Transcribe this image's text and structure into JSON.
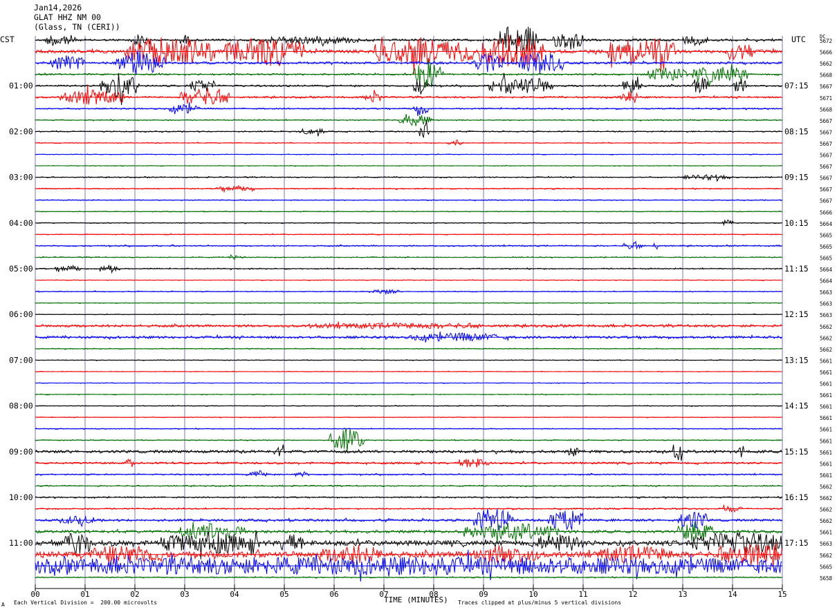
{
  "header": {
    "date": "Jan14,2026",
    "station": "GLAT HHZ NM 00",
    "location": "(Glass, TN (CERI))"
  },
  "left_timezone": "CST",
  "right_timezone": "UTC",
  "dc_label": "DC",
  "footer": {
    "scale_note": "Each Vertical Division =  200.00 microvolts",
    "clip_note": "Traces clipped at plus/minus 5 vertical divisions",
    "corner_mark": "A"
  },
  "colors": [
    "#000000",
    "#ff0000",
    "#0000ff",
    "#007000"
  ],
  "chart_data": {
    "type": "line",
    "title": "GLAT HHZ NM 00",
    "xlabel": "TIME (MINUTES)",
    "x_ticks": [
      "00",
      "01",
      "02",
      "03",
      "04",
      "05",
      "06",
      "07",
      "08",
      "09",
      "10",
      "11",
      "12",
      "13",
      "14",
      "15"
    ],
    "xlim": [
      0,
      15
    ],
    "grid": true,
    "rows": 48,
    "left_hour_labels": [
      "01:00",
      "02:00",
      "03:00",
      "04:00",
      "05:00",
      "06:00",
      "07:00",
      "08:00",
      "09:00",
      "10:00",
      "11:00"
    ],
    "right_hour_labels": [
      "07:15",
      "08:15",
      "09:15",
      "10:15",
      "11:15",
      "12:15",
      "13:15",
      "14:15",
      "15:15",
      "16:15",
      "17:15"
    ],
    "dc_offsets": [
      "5672",
      "5666",
      "5662",
      "5668",
      "5667",
      "5671",
      "5668",
      "5667",
      "5667",
      "5667",
      "5667",
      "5667",
      "5667",
      "5667",
      "5667",
      "5666",
      "5664",
      "5665",
      "5665",
      "5665",
      "5664",
      "5664",
      "5663",
      "5663",
      "5663",
      "5662",
      "5662",
      "5662",
      "5661",
      "5661",
      "5661",
      "5661",
      "5661",
      "5661",
      "5661",
      "5661",
      "5661",
      "5661",
      "5661",
      "5662",
      "5662",
      "5662",
      "5662",
      "5661",
      "5663",
      "5662",
      "5665",
      "5658"
    ],
    "row_noise": [
      {
        "row": 0,
        "base": 0.18,
        "events": [
          [
            0.2,
            0.8,
            1.2
          ],
          [
            1.9,
            2.3,
            1.0
          ],
          [
            2.9,
            3.1,
            0.9
          ],
          [
            4.5,
            6.5,
            0.6
          ],
          [
            9.3,
            10.1,
            3.0
          ],
          [
            10.4,
            11.0,
            1.8
          ],
          [
            13.0,
            13.5,
            0.8
          ]
        ]
      },
      {
        "row": 1,
        "base": 0.3,
        "events": [
          [
            1.8,
            3.6,
            2.6
          ],
          [
            3.8,
            5.4,
            2.6
          ],
          [
            6.8,
            8.8,
            2.4
          ],
          [
            8.9,
            10.2,
            3.0
          ],
          [
            11.5,
            12.9,
            2.6
          ],
          [
            13.8,
            14.4,
            1.6
          ]
        ]
      },
      {
        "row": 2,
        "base": 0.2,
        "events": [
          [
            0.3,
            1.0,
            1.4
          ],
          [
            1.6,
            2.6,
            2.2
          ],
          [
            8.8,
            9.4,
            1.6
          ],
          [
            9.7,
            10.6,
            2.0
          ]
        ]
      },
      {
        "row": 3,
        "base": 0.14,
        "events": [
          [
            7.6,
            8.2,
            2.6
          ],
          [
            12.3,
            13.1,
            1.2
          ],
          [
            13.2,
            14.3,
            1.5
          ]
        ]
      },
      {
        "row": 4,
        "base": 0.15,
        "events": [
          [
            1.3,
            2.1,
            2.4
          ],
          [
            3.1,
            3.6,
            1.3
          ],
          [
            7.6,
            7.9,
            1.6
          ],
          [
            9.1,
            10.4,
            1.6
          ],
          [
            11.8,
            12.2,
            2.0
          ],
          [
            13.2,
            13.5,
            1.6
          ],
          [
            14.0,
            14.3,
            1.2
          ]
        ]
      },
      {
        "row": 5,
        "base": 0.15,
        "events": [
          [
            0.5,
            1.8,
            1.3
          ],
          [
            2.9,
            3.9,
            1.6
          ],
          [
            6.6,
            7.0,
            0.8
          ],
          [
            11.7,
            12.1,
            1.1
          ]
        ]
      },
      {
        "row": 6,
        "base": 0.12,
        "events": [
          [
            2.7,
            3.3,
            0.8
          ],
          [
            7.6,
            7.9,
            1.2
          ]
        ]
      },
      {
        "row": 7,
        "base": 0.1,
        "events": [
          [
            7.3,
            8.0,
            1.0
          ]
        ]
      },
      {
        "row": 8,
        "base": 0.1,
        "events": [
          [
            5.3,
            5.8,
            0.6
          ],
          [
            7.7,
            7.9,
            1.4
          ]
        ]
      },
      {
        "row": 9,
        "base": 0.08,
        "events": [
          [
            8.3,
            8.6,
            0.5
          ]
        ]
      },
      {
        "row": 10,
        "base": 0.06,
        "events": []
      },
      {
        "row": 11,
        "base": 0.06,
        "events": []
      },
      {
        "row": 12,
        "base": 0.09,
        "events": [
          [
            13.0,
            14.0,
            0.4
          ]
        ]
      },
      {
        "row": 13,
        "base": 0.1,
        "events": [
          [
            3.6,
            4.4,
            0.4
          ]
        ]
      },
      {
        "row": 14,
        "base": 0.08,
        "events": []
      },
      {
        "row": 15,
        "base": 0.07,
        "events": []
      },
      {
        "row": 16,
        "base": 0.08,
        "events": [
          [
            13.8,
            14.0,
            0.6
          ]
        ]
      },
      {
        "row": 17,
        "base": 0.07,
        "events": []
      },
      {
        "row": 18,
        "base": 0.12,
        "events": [
          [
            11.8,
            12.2,
            0.6
          ],
          [
            12.4,
            12.5,
            0.9
          ]
        ]
      },
      {
        "row": 19,
        "base": 0.08,
        "events": [
          [
            3.9,
            4.2,
            0.4
          ]
        ]
      },
      {
        "row": 20,
        "base": 0.1,
        "events": [
          [
            0.4,
            0.9,
            0.5
          ],
          [
            1.3,
            1.7,
            0.7
          ]
        ]
      },
      {
        "row": 21,
        "base": 0.06,
        "events": []
      },
      {
        "row": 22,
        "base": 0.08,
        "events": [
          [
            6.7,
            7.3,
            0.4
          ]
        ]
      },
      {
        "row": 23,
        "base": 0.06,
        "events": []
      },
      {
        "row": 24,
        "base": 0.06,
        "events": []
      },
      {
        "row": 25,
        "base": 0.22,
        "events": [
          [
            5.5,
            9.0,
            0.35
          ]
        ]
      },
      {
        "row": 26,
        "base": 0.22,
        "events": [
          [
            7.5,
            9.5,
            0.6
          ]
        ]
      },
      {
        "row": 27,
        "base": 0.08,
        "events": []
      },
      {
        "row": 28,
        "base": 0.06,
        "events": []
      },
      {
        "row": 29,
        "base": 0.06,
        "events": []
      },
      {
        "row": 30,
        "base": 0.06,
        "events": []
      },
      {
        "row": 31,
        "base": 0.07,
        "events": []
      },
      {
        "row": 32,
        "base": 0.07,
        "events": []
      },
      {
        "row": 33,
        "base": 0.06,
        "events": []
      },
      {
        "row": 34,
        "base": 0.08,
        "events": []
      },
      {
        "row": 35,
        "base": 0.08,
        "events": [
          [
            5.9,
            6.6,
            2.2
          ]
        ]
      },
      {
        "row": 36,
        "base": 0.25,
        "events": [
          [
            4.8,
            5.0,
            0.9
          ],
          [
            10.7,
            10.9,
            0.8
          ],
          [
            12.8,
            13.0,
            1.8
          ],
          [
            14.1,
            14.3,
            0.9
          ]
        ]
      },
      {
        "row": 37,
        "base": 0.18,
        "events": [
          [
            1.8,
            2.0,
            0.7
          ],
          [
            8.5,
            9.1,
            0.9
          ]
        ]
      },
      {
        "row": 38,
        "base": 0.12,
        "events": [
          [
            4.3,
            4.7,
            0.7
          ],
          [
            5.2,
            5.5,
            0.5
          ]
        ]
      },
      {
        "row": 39,
        "base": 0.1,
        "events": []
      },
      {
        "row": 40,
        "base": 0.12,
        "events": []
      },
      {
        "row": 41,
        "base": 0.12,
        "events": [
          [
            13.8,
            14.2,
            0.5
          ]
        ]
      },
      {
        "row": 42,
        "base": 0.2,
        "events": [
          [
            0.5,
            1.2,
            0.6
          ],
          [
            8.8,
            9.6,
            2.2
          ],
          [
            10.3,
            11.0,
            2.0
          ],
          [
            12.9,
            13.5,
            1.8
          ]
        ]
      },
      {
        "row": 43,
        "base": 0.25,
        "events": [
          [
            2.9,
            4.2,
            1.4
          ],
          [
            8.6,
            10.5,
            1.4
          ],
          [
            12.9,
            13.6,
            1.6
          ]
        ]
      },
      {
        "row": 44,
        "base": 0.45,
        "events": [
          [
            0.6,
            1.1,
            2.0
          ],
          [
            2.5,
            4.5,
            1.6
          ],
          [
            4.9,
            5.4,
            1.3
          ],
          [
            10.0,
            11.0,
            1.3
          ],
          [
            13.2,
            15.0,
            1.8
          ]
        ]
      },
      {
        "row": 45,
        "base": 0.5,
        "events": [
          [
            1.1,
            2.6,
            1.4
          ],
          [
            5.7,
            7.0,
            1.3
          ],
          [
            8.8,
            10.1,
            1.3
          ],
          [
            11.3,
            12.8,
            1.2
          ],
          [
            13.7,
            15.0,
            1.6
          ]
        ]
      },
      {
        "row": 46,
        "base": 0.9,
        "events": [
          [
            0.0,
            15.0,
            0.8
          ]
        ]
      },
      {
        "row": 47,
        "base": 0.1,
        "events": []
      }
    ]
  }
}
